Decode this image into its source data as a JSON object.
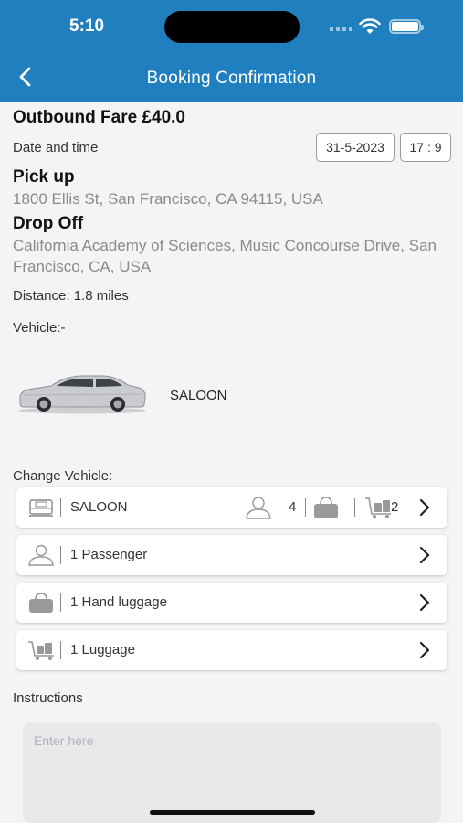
{
  "status_bar": {
    "time": "5:10"
  },
  "header": {
    "title": "Booking Confirmation"
  },
  "booking": {
    "fare": "Outbound Fare £40.0",
    "date_time_label": "Date and time",
    "date": "31-5-2023",
    "time": "17 : 9",
    "pickup_label": "Pick up",
    "pickup_address": "1800 Ellis St, San Francisco, CA 94115, USA",
    "dropoff_label": "Drop Off",
    "dropoff_address": "California Academy of Sciences, Music Concourse Drive, San Francisco, CA, USA",
    "distance": "Distance: 1.8 miles",
    "vehicle_label": "Vehicle:-",
    "vehicle_type": "SALOON"
  },
  "change_vehicle": {
    "label": "Change Vehicle:",
    "vehicle": {
      "name": "SALOON",
      "passengers": "4",
      "luggage": "2"
    },
    "passenger_label": "1 Passenger",
    "hand_luggage_label": "1 Hand luggage",
    "luggage_label": "1 Luggage"
  },
  "instructions": {
    "label": "Instructions",
    "placeholder": "Enter here"
  },
  "colors": {
    "header": "#1f7fbf",
    "background": "#f4f4f6"
  },
  "icons": [
    "back-arrow-icon",
    "wifi-icon",
    "battery-icon",
    "taxi-icon",
    "person-icon",
    "handbag-icon",
    "luggage-trolley-icon",
    "chevron-right-icon"
  ]
}
